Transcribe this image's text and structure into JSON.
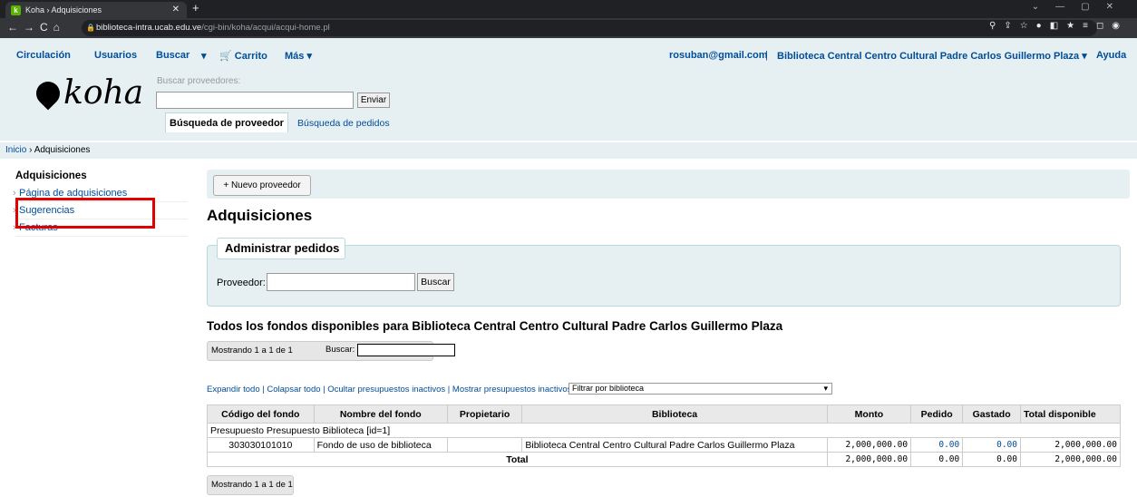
{
  "browser": {
    "tab_title": "Koha › Adquisiciones",
    "url_host": "biblioteca-intra.ucab.edu.ve",
    "url_path": "/cgi-bin/koha/acqui/acqui-home.pl"
  },
  "topnav": {
    "circulacion": "Circulación",
    "usuarios": "Usuarios",
    "buscar": "Buscar",
    "carrito": "Carrito",
    "mas": "Más ▾",
    "user": "rosuban@gmail.com",
    "library": "Biblioteca Central Centro Cultural Padre Carlos Guillermo Plaza ▾",
    "ayuda": "Ayuda"
  },
  "header": {
    "logo": "koha",
    "search_label": "Buscar proveedores:",
    "enviar": "Enviar",
    "tab_proveedor": "Búsqueda de proveedor",
    "tab_pedidos": "Búsqueda de pedidos"
  },
  "breadcrumb": {
    "inicio": "Inicio",
    "sep": " › ",
    "current": "Adquisiciones"
  },
  "sidebar": {
    "title": "Adquisiciones",
    "items": [
      {
        "label": "Página de adquisiciones"
      },
      {
        "label": "Sugerencias"
      },
      {
        "label": "Facturas"
      }
    ]
  },
  "main": {
    "new_vendor": "+ Nuevo proveedor",
    "title": "Adquisiciones",
    "legend": "Administrar pedidos",
    "prov_label": "Proveedor:",
    "prov_button": "Buscar",
    "funds_title": "Todos los fondos disponibles para Biblioteca Central Centro Cultural Padre Carlos Guillermo Plaza",
    "pager_text": "Mostrando 1 a 1 de 1",
    "pager_search": "Buscar:",
    "links": "Expandir todo | Colapsar todo | Ocultar presupuestos inactivos | Mostrar presupuestos inactivos |",
    "filter": "Filtrar por biblioteca"
  },
  "table": {
    "headers": [
      "Código del fondo",
      "Nombre del fondo",
      "Propietario",
      "Biblioteca",
      "Monto",
      "Pedido",
      "Gastado",
      "Total disponible"
    ],
    "group": "Presupuesto Presupuesto Biblioteca [id=1]",
    "row": {
      "code": "303030101010",
      "name": "Fondo de uso de biblioteca",
      "owner": "",
      "library": "Biblioteca Central Centro Cultural Padre Carlos Guillermo Plaza",
      "amount": "2,000,000.00",
      "ordered": "0.00",
      "spent": "0.00",
      "available": "2,000,000.00"
    },
    "total": {
      "label": "Total",
      "amount": "2,000,000.00",
      "ordered": "0.00",
      "spent": "0.00",
      "available": "2,000,000.00"
    }
  },
  "colors": {
    "link": "#004d99",
    "header_bg": "#e6f0f2",
    "highlight": "#e00000"
  }
}
